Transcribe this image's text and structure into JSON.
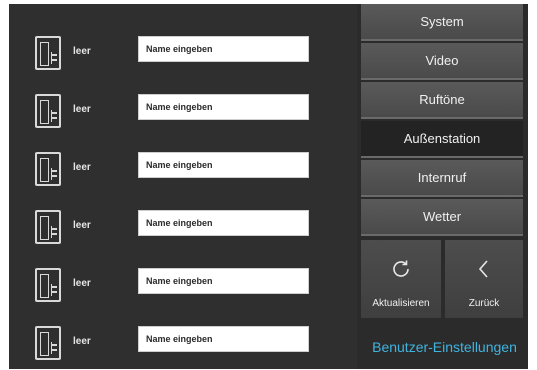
{
  "stations": [
    {
      "label": "leer",
      "placeholder": "Name eingeben"
    },
    {
      "label": "leer",
      "placeholder": "Name eingeben"
    },
    {
      "label": "leer",
      "placeholder": "Name eingeben"
    },
    {
      "label": "leer",
      "placeholder": "Name eingeben"
    },
    {
      "label": "leer",
      "placeholder": "Name eingeben"
    },
    {
      "label": "leer",
      "placeholder": "Name eingeben"
    }
  ],
  "menu": {
    "items": [
      {
        "label": "System"
      },
      {
        "label": "Video"
      },
      {
        "label": "Ruftöne"
      },
      {
        "label": "Außenstation",
        "active": true
      },
      {
        "label": "Internruf"
      },
      {
        "label": "Wetter"
      }
    ],
    "refresh_label": "Aktualisieren",
    "back_label": "Zurück",
    "refresh_icon": "refresh-icon",
    "back_icon": "chevron-left-icon"
  },
  "footer": {
    "title": "Benutzer-Einstellungen"
  },
  "colors": {
    "accent": "#3fb4e0",
    "panel": "#2f2f2f",
    "button": "#555555",
    "active": "#232323"
  }
}
